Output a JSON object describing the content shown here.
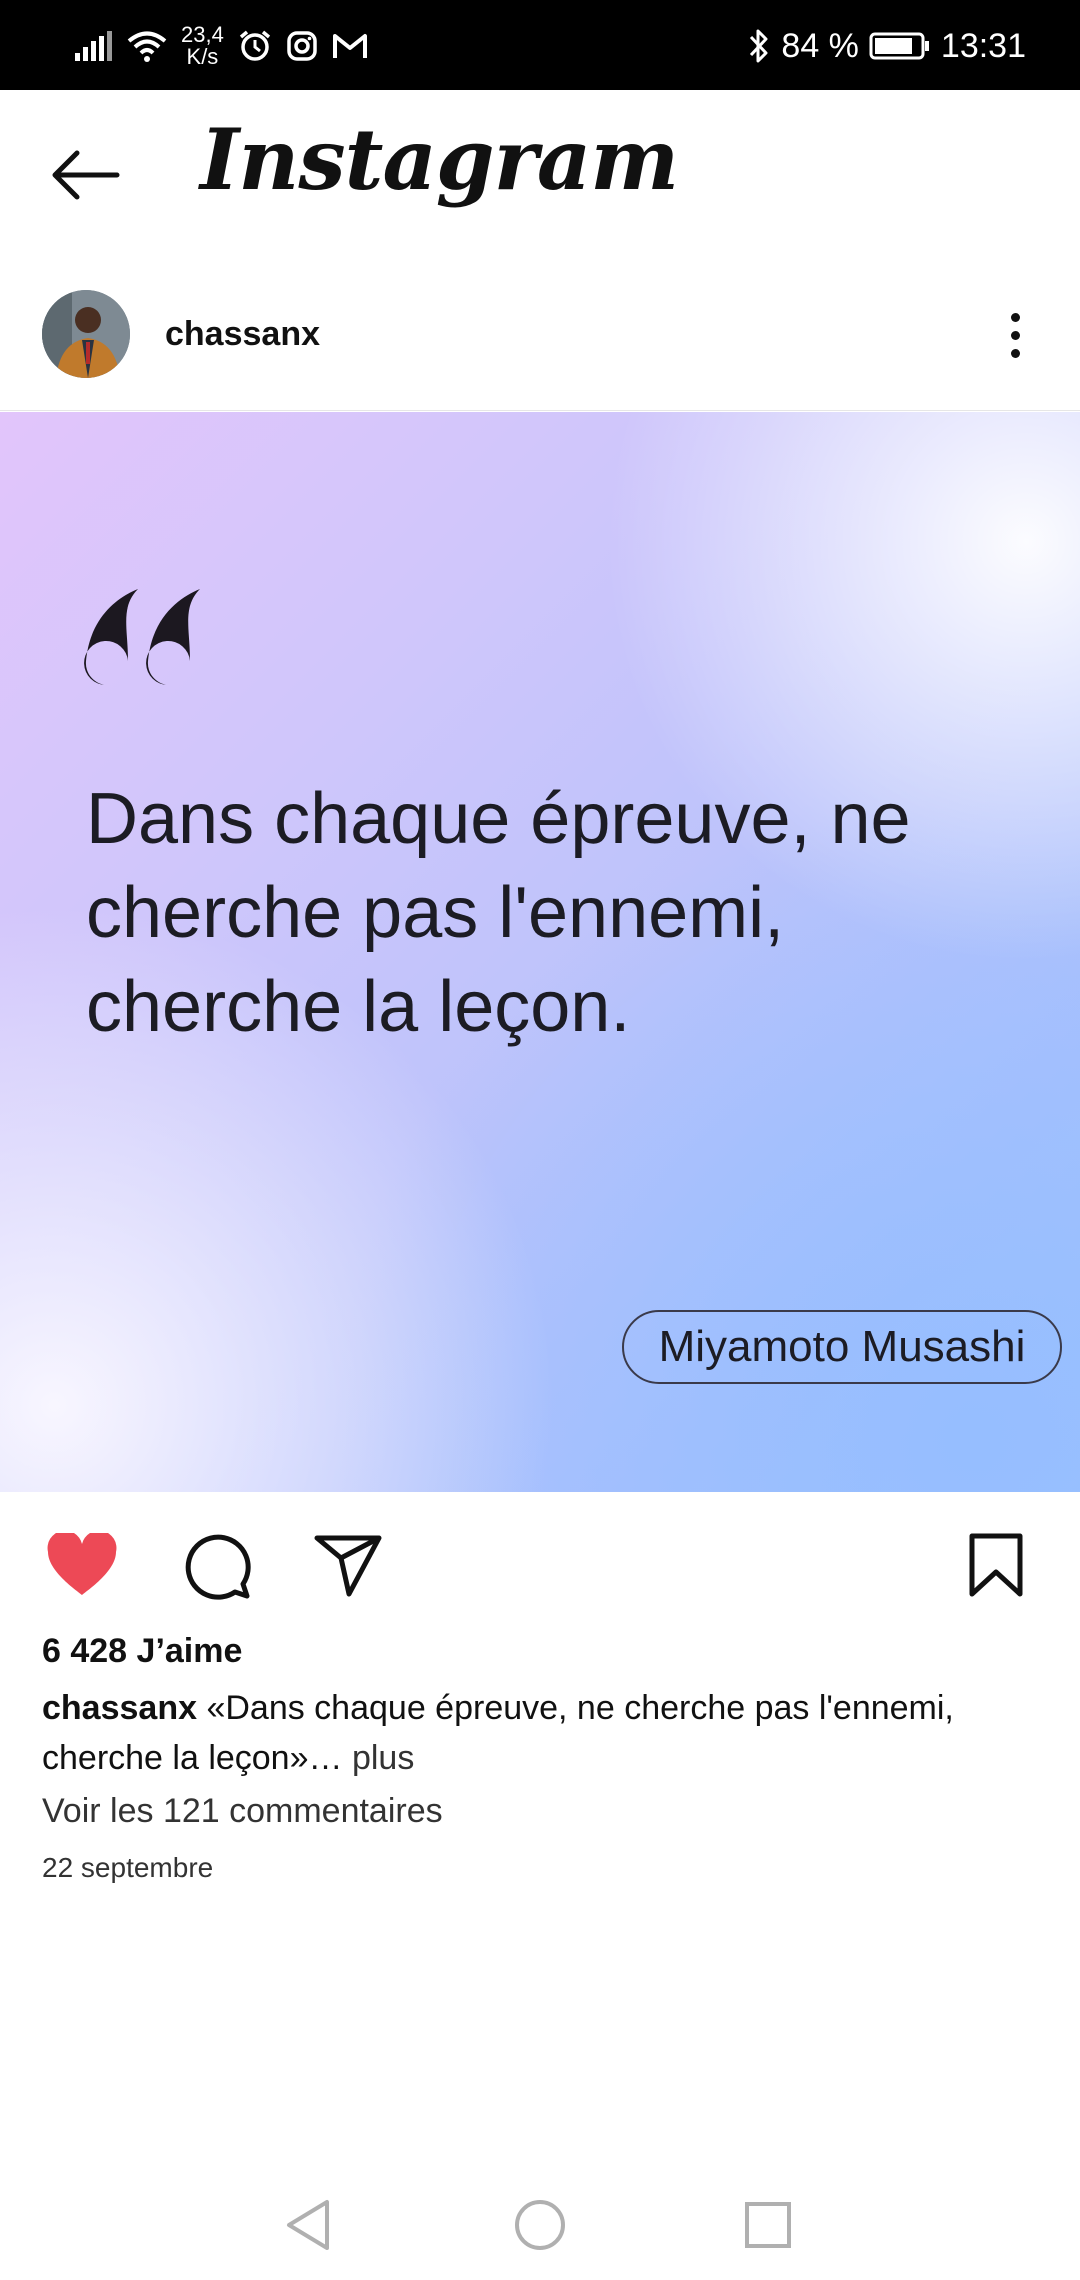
{
  "status_bar": {
    "speed_value": "23,4",
    "speed_unit": "K/s",
    "battery_percent": "84 %",
    "time": "13:31",
    "left_icons": [
      "signal-icon",
      "wifi-icon",
      "alarm-icon",
      "instagram-notification-icon",
      "gmail-notification-icon"
    ],
    "right_icons": [
      "bluetooth-icon",
      "battery-icon"
    ]
  },
  "app_bar": {
    "title": "Instagram",
    "back_icon": "arrow-left-icon"
  },
  "post": {
    "username": "chassanx",
    "more_icon": "more-vertical-icon",
    "image": {
      "quote": "Dans chaque épreuve, ne cherche pas l'ennemi, cherche la leçon.",
      "author": "Miyamoto Musashi",
      "gradient_colors": [
        "#e2c5fb",
        "#bcc3fb",
        "#9dc3fe"
      ]
    },
    "actions": {
      "like_icon": "heart-filled-icon",
      "like_color": "#ed4956",
      "comment_icon": "comment-icon",
      "share_icon": "send-icon",
      "save_icon": "bookmark-icon"
    },
    "likes": "6 428 J’aime",
    "caption_user": "chassanx",
    "caption_text": "«Dans chaque épreuve, ne cherche pas l'ennemi, cherche la leçon»…",
    "caption_more": "plus",
    "comments_link": "Voir les 121 commentaires",
    "date": "22 septembre"
  },
  "nav_bar": {
    "back_icon": "nav-back-icon",
    "home_icon": "nav-home-icon",
    "recents_icon": "nav-recents-icon"
  }
}
